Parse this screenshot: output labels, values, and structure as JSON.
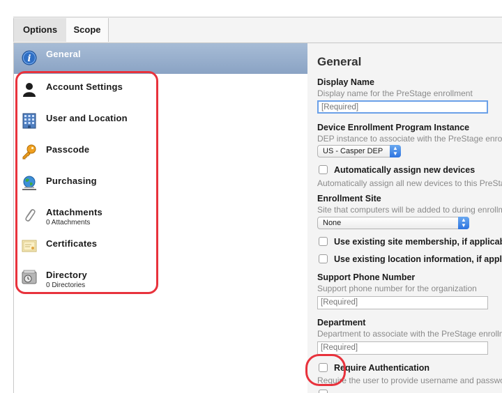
{
  "tabs": [
    {
      "label": "Options"
    },
    {
      "label": "Scope"
    }
  ],
  "sidebar": {
    "items": [
      {
        "label": "General",
        "icon": "info-icon"
      },
      {
        "label": "Account Settings",
        "icon": "user-silhouette-icon"
      },
      {
        "label": "User and Location",
        "icon": "building-icon"
      },
      {
        "label": "Passcode",
        "icon": "key-icon"
      },
      {
        "label": "Purchasing",
        "icon": "globe-icon"
      },
      {
        "label": "Attachments",
        "sub": "0 Attachments",
        "icon": "paperclip-icon"
      },
      {
        "label": "Certificates",
        "icon": "certificate-icon"
      },
      {
        "label": "Directory",
        "sub": "0 Directories",
        "icon": "directory-icon"
      }
    ]
  },
  "main": {
    "title": "General",
    "display_name": {
      "label": "Display Name",
      "desc": "Display name for the PreStage enrollment",
      "placeholder": "[Required]"
    },
    "dep_instance": {
      "label": "Device Enrollment Program Instance",
      "desc": "DEP instance to associate with the PreStage enrollment",
      "value": "US - Casper DEP"
    },
    "auto_assign": {
      "label": "Automatically assign new devices",
      "desc": "Automatically assign all new devices to this PreStage enrollment"
    },
    "enrollment_site": {
      "label": "Enrollment Site",
      "desc": "Site that computers will be added to during enrollment",
      "value": "None"
    },
    "site_membership": {
      "label": "Use existing site membership, if applicable"
    },
    "location_info": {
      "label": "Use existing location information, if applicable"
    },
    "support_phone": {
      "label": "Support Phone Number",
      "desc": "Support phone number for the organization",
      "placeholder": "[Required]"
    },
    "department": {
      "label": "Department",
      "desc": "Department to associate with the PreStage enrollment",
      "placeholder": "[Required]"
    },
    "require_auth": {
      "label": "Require Authentication",
      "desc": "Require the user to provide username and password"
    }
  },
  "colors": {
    "highlight": "#e8323c",
    "selected_row": "#8aa3c4",
    "focus_ring": "#6aa0e8"
  }
}
